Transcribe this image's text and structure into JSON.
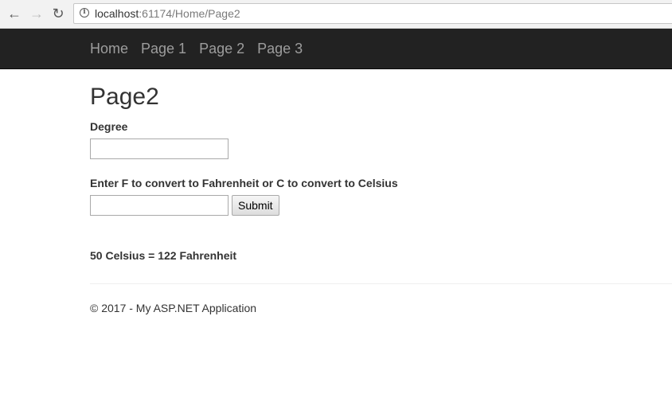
{
  "browser": {
    "url_host": "localhost",
    "url_path": ":61174/Home/Page2",
    "icons": [
      "back-arrow-icon",
      "forward-arrow-icon",
      "reload-icon",
      "info-icon"
    ]
  },
  "navbar": {
    "links": [
      {
        "label": "Home"
      },
      {
        "label": "Page 1"
      },
      {
        "label": "Page 2"
      },
      {
        "label": "Page 3"
      }
    ]
  },
  "page": {
    "title": "Page2",
    "degree_label": "Degree",
    "degree_value": "",
    "unit_label": "Enter F to convert to Fahrenheit or C to convert to Celsius",
    "unit_value": "",
    "submit_label": "Submit",
    "result": "50 Celsius = 122 Fahrenheit"
  },
  "footer": {
    "text": "© 2017 - My ASP.NET Application"
  },
  "colors": {
    "navbar_bg": "#222222",
    "nav_link": "#9d9d9d",
    "text": "#333333"
  }
}
